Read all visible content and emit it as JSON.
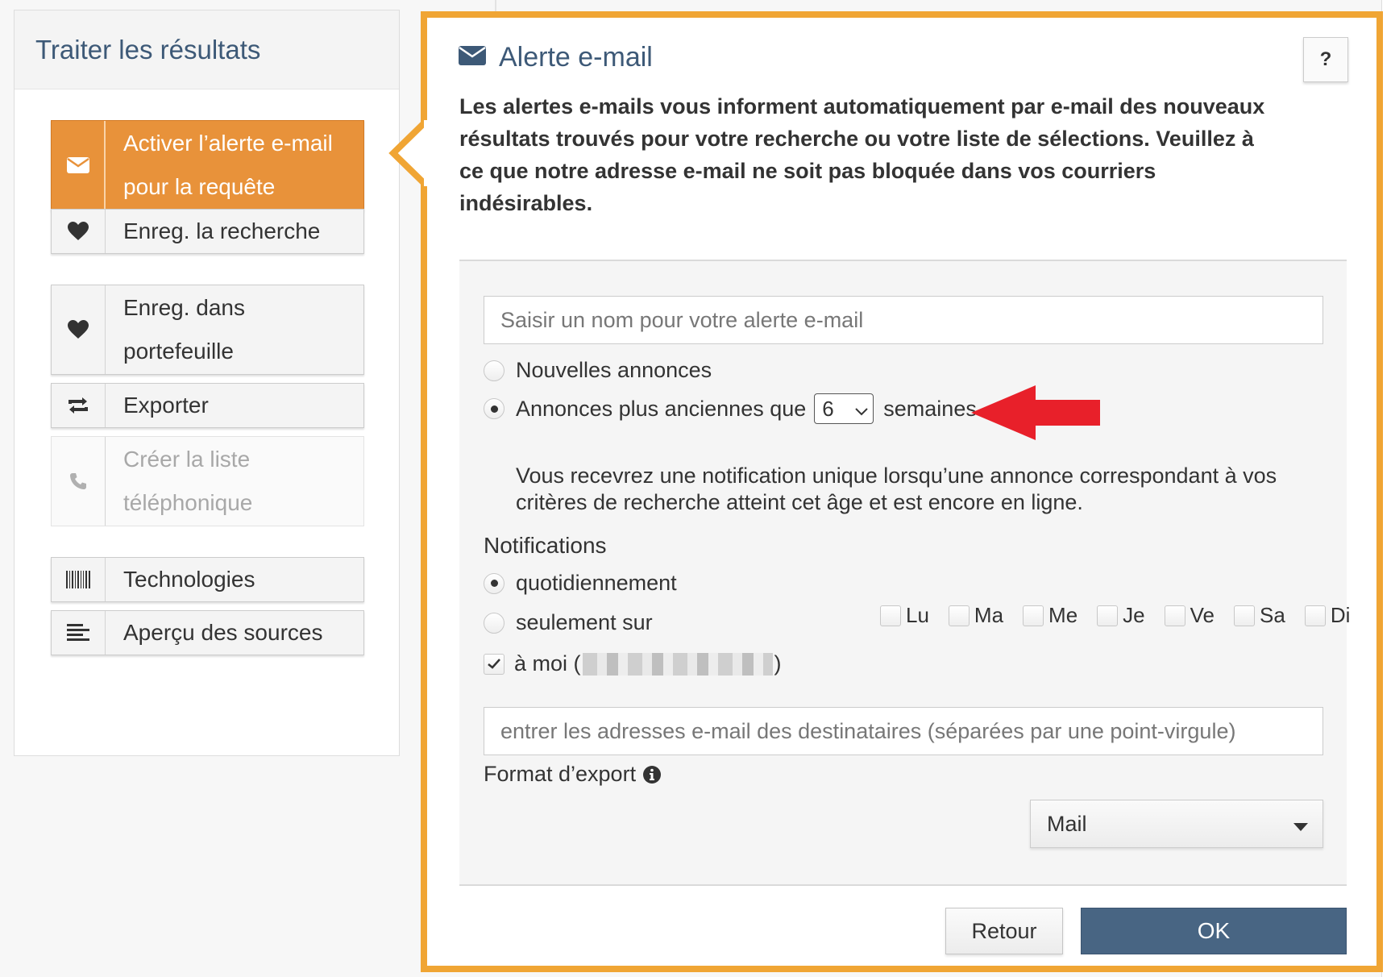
{
  "left_panel": {
    "title": "Traiter les résultats",
    "items": [
      {
        "icon": "envelope-icon",
        "label_line1": "Activer l’alerte e-mail",
        "label_line2": "pour la requête",
        "state": "active"
      },
      {
        "icon": "heart-icon",
        "label": "Enreg. la recherche"
      },
      {
        "icon": "heart-icon",
        "label_line1": "Enreg. dans",
        "label_line2": "portefeuille"
      },
      {
        "icon": "retweet-icon",
        "label": "Exporter"
      },
      {
        "icon": "phone-icon",
        "label_line1": "Créer la liste",
        "label_line2": "téléphonique",
        "state": "disabled"
      },
      {
        "icon": "barcode-icon",
        "label": "Technologies"
      },
      {
        "icon": "align-left-icon",
        "label": "Aperçu des sources"
      }
    ]
  },
  "dialog": {
    "title": "Alerte e-mail",
    "help_label": "?",
    "intro": "Les alertes e-mails vous informent automatiquement par e-mail des nouveaux résultats trouvés pour votre recherche ou votre liste de sélections. Veuillez à ce que notre adresse e-mail ne soit pas bloquée dans vos courriers indésirables.",
    "name_placeholder": "Saisir un nom pour votre alerte e-mail",
    "type_options": {
      "new": {
        "label": "Nouvelles annonces",
        "selected": false
      },
      "older": {
        "label_before": "Annonces plus anciennes que",
        "weeks_value": "6",
        "label_after": "semaines",
        "selected": true
      }
    },
    "older_help": "Vous recevrez une notification unique lorsqu’une annonce correspondant à vos critères de recherche atteint cet âge et est encore en ligne.",
    "notifications": {
      "label": "Notifications",
      "daily": {
        "label": "quotidiennement",
        "selected": true
      },
      "only_on": {
        "label": "seulement sur",
        "selected": false
      },
      "days": [
        "Lu",
        "Ma",
        "Me",
        "Je",
        "Ve",
        "Sa",
        "Di"
      ]
    },
    "to_me": {
      "prefix": "à moi (",
      "suffix": ")",
      "checked": true
    },
    "recipients_placeholder": "entrer les adresses e-mail des destinataires (séparées par une point-virgule)",
    "export_format": {
      "label": "Format d’export",
      "value": "Mail"
    },
    "buttons": {
      "back": "Retour",
      "ok": "OK"
    }
  },
  "colors": {
    "accent_orange": "#e8923a",
    "dialog_border": "#f0a534",
    "title_blue": "#3d5977",
    "ok_button": "#486583",
    "annotation_arrow": "#e8202a"
  }
}
